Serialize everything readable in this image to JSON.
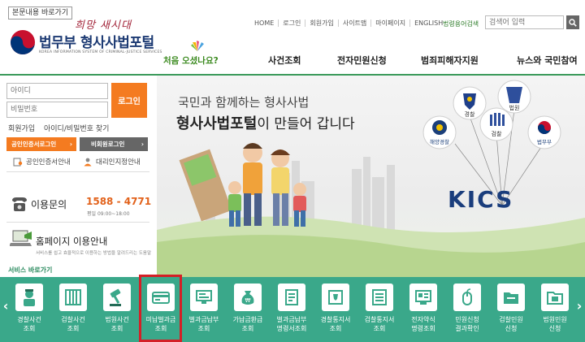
{
  "header": {
    "skip_link": "본문내용 바로가기",
    "slogan": "희망 새시대",
    "title": "법무부 형사사법포털",
    "subtitle": "KOREA INFORMATION SYSTEM OF CRIMINAL-JUSTICE SERVICES",
    "util_nav": [
      "HOME",
      "로그인",
      "회원가입",
      "사이트맵",
      "마이페이지",
      "ENGLISH"
    ],
    "glossary": "법령용어검색",
    "search_placeholder": "검색어 입력"
  },
  "main_nav": {
    "first": "처음 오셨나요?",
    "items": [
      "사건조회",
      "전자민원신청",
      "범죄피해자지원",
      "뉴스와 국민참여"
    ]
  },
  "login": {
    "id_placeholder": "아이디",
    "pw_placeholder": "비밀번호",
    "login_button": "로그인",
    "signup": "회원가입",
    "find": "아이디/비밀번호 찾기",
    "cert_login": "공인인증서로그인",
    "nonmember_login": "비회원로그인",
    "cert_guide": "공인인증서안내",
    "proxy_guide": "대리인지정안내"
  },
  "contact": {
    "label": "이용문의",
    "phone": "1588 - 4771",
    "hours": "평일 09:00~18:00"
  },
  "guide": {
    "label": "홈페이지 이용안내",
    "desc": "서비스를 쉽고 효율적으로 이용하는 방법을 알려드리는 도움말"
  },
  "banner": {
    "line1": "국민과 함께하는 형사사법",
    "line2_bold": "형사사법포털",
    "line2_rest": "이 만들어 갑니다",
    "balloons": [
      "경찰",
      "법원",
      "해양경찰",
      "검찰",
      "법무부"
    ],
    "kics": "KICS"
  },
  "services": {
    "title": "서비스 바로가기",
    "items": [
      {
        "label": "경찰사건\n조회",
        "icon": "police-officer-icon"
      },
      {
        "label": "검찰사건\n조회",
        "icon": "prison-bars-icon"
      },
      {
        "label": "법원사건\n조회",
        "icon": "gavel-icon"
      },
      {
        "label": "미납벌과금\n조회",
        "icon": "card-reader-icon"
      },
      {
        "label": "벌과금납부\n조회",
        "icon": "monitor-icon"
      },
      {
        "label": "가납금환급\n조회",
        "icon": "money-bag-icon"
      },
      {
        "label": "벌과금납부\n명령서조회",
        "icon": "document-icon"
      },
      {
        "label": "경찰통지서\n조회",
        "icon": "police-notice-icon"
      },
      {
        "label": "검찰통지서\n조회",
        "icon": "prosecution-notice-icon"
      },
      {
        "label": "전자약식\n명령조회",
        "icon": "electronic-order-icon"
      },
      {
        "label": "민원신청\n결과확인",
        "icon": "mouse-icon"
      },
      {
        "label": "검찰민원\n신청",
        "icon": "folder-icon"
      },
      {
        "label": "법원민원\n신청",
        "icon": "court-folder-icon"
      }
    ]
  },
  "colors": {
    "accent_orange": "#f47b20",
    "service_green": "#3aa88a",
    "nav_green": "#3b8a1f",
    "highlight_red": "#d41f26",
    "title_navy": "#1c3a73"
  }
}
